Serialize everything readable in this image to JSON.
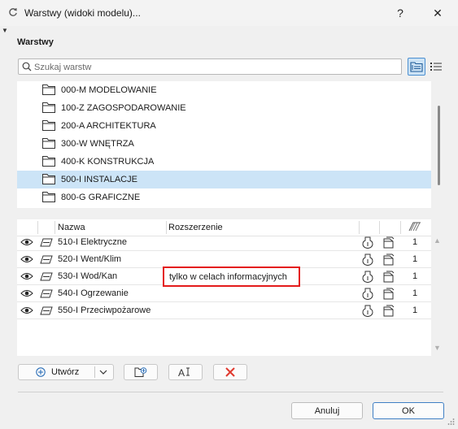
{
  "window": {
    "title": "Warstwy (widoki modelu)...",
    "help_label": "?",
    "close_label": "✕"
  },
  "section": {
    "label": "Warstwy"
  },
  "search": {
    "placeholder": "Szukaj warstw",
    "value": ""
  },
  "folders": [
    {
      "label": "000-M MODELOWANIE",
      "selected": false
    },
    {
      "label": "100-Z ZAGOSPODAROWANIE",
      "selected": false
    },
    {
      "label": "200-A ARCHITEKTURA",
      "selected": false
    },
    {
      "label": "300-W WNĘTRZA",
      "selected": false
    },
    {
      "label": "400-K KONSTRUKCJA",
      "selected": false
    },
    {
      "label": "500-I INSTALACJE",
      "selected": true
    },
    {
      "label": "800-G GRAFICZNE",
      "selected": false
    }
  ],
  "layers_table": {
    "columns": {
      "name": "Nazwa",
      "extension": "Rozszerzenie"
    },
    "rows": [
      {
        "name": "510-I Elektryczne",
        "extension": "",
        "intersection_group": "1"
      },
      {
        "name": "520-I Went/Klim",
        "extension": "",
        "intersection_group": "1"
      },
      {
        "name": "530-I Wod/Kan",
        "extension": "tylko w celach informacyjnych",
        "intersection_group": "1"
      },
      {
        "name": "540-I Ogrzewanie",
        "extension": "",
        "intersection_group": "1"
      },
      {
        "name": "550-I Przeciwpożarowe",
        "extension": "",
        "intersection_group": "1"
      }
    ]
  },
  "toolbar": {
    "create_label": "Utwórz"
  },
  "footer": {
    "cancel_label": "Anuluj",
    "ok_label": "OK"
  },
  "colors": {
    "selection": "#cce4f7",
    "accent": "#4b8fd1",
    "highlight_border": "#e41b1b",
    "delete_icon": "#e03a2f"
  }
}
